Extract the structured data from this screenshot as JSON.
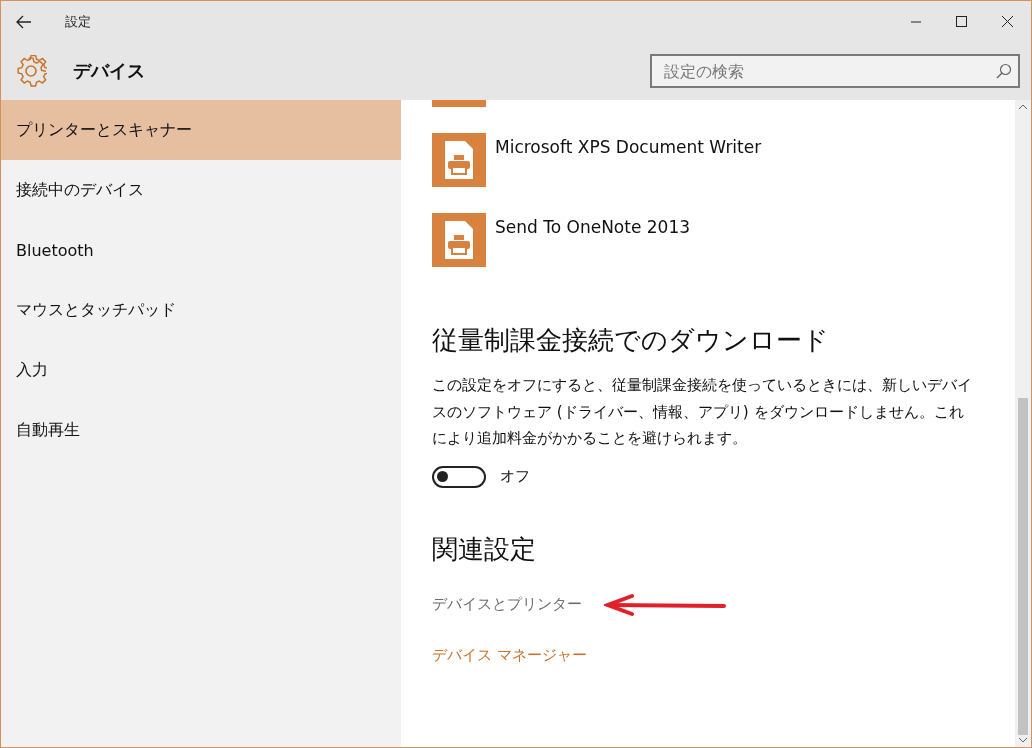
{
  "window": {
    "title": "設定"
  },
  "header": {
    "title": "デバイス"
  },
  "search": {
    "placeholder": "設定の検索"
  },
  "sidebar": {
    "items": [
      {
        "label": "プリンターとスキャナー",
        "selected": true
      },
      {
        "label": "接続中のデバイス",
        "selected": false
      },
      {
        "label": "Bluetooth",
        "selected": false
      },
      {
        "label": "マウスとタッチパッド",
        "selected": false
      },
      {
        "label": "入力",
        "selected": false
      },
      {
        "label": "自動再生",
        "selected": false
      }
    ]
  },
  "printers": [
    {
      "clipped": true
    },
    {
      "name": "Microsoft XPS Document Writer",
      "clipped": false
    },
    {
      "name": "Send To OneNote 2013",
      "clipped": false
    }
  ],
  "metered": {
    "heading": "従量制課金接続でのダウンロード",
    "description": "この設定をオフにすると、従量制課金接続を使っているときには、新しいデバイスのソフトウェア (ドライバー、情報、アプリ) をダウンロードしません。これにより追加料金がかかることを避けられます。",
    "toggle": {
      "on": false,
      "label": "オフ"
    }
  },
  "related": {
    "heading": "関連設定",
    "links": [
      {
        "label": "デバイスとプリンター",
        "color": "#6d6d6d"
      },
      {
        "label": "デバイス マネージャー",
        "color": "#c8732a"
      }
    ]
  },
  "annotations": [
    {
      "kind": "arrow"
    }
  ]
}
